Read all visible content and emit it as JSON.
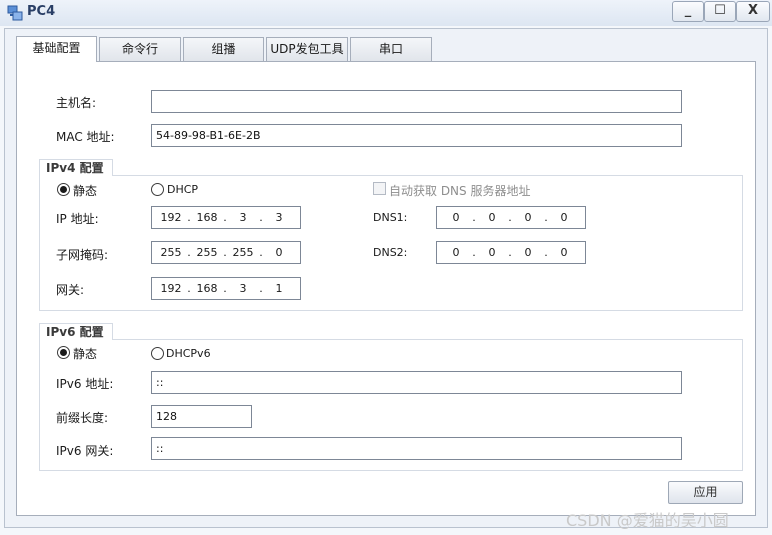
{
  "window": {
    "title": "PC4",
    "minimize": "_",
    "maximize": "☐",
    "close": "X"
  },
  "tabs": [
    {
      "label": "基础配置",
      "active": true
    },
    {
      "label": "命令行",
      "active": false
    },
    {
      "label": "组播",
      "active": false
    },
    {
      "label": "UDP发包工具",
      "active": false
    },
    {
      "label": "串口",
      "active": false
    }
  ],
  "basic": {
    "hostname_label": "主机名:",
    "hostname_value": "",
    "mac_label": "MAC 地址:",
    "mac_value": "54-89-98-B1-6E-2B"
  },
  "ipv4": {
    "section_title": "IPv4 配置",
    "static_label": "静态",
    "dhcp_label": "DHCP",
    "mode": "static",
    "auto_dns_label": "自动获取 DNS 服务器地址",
    "ip_label": "IP 地址:",
    "ip": [
      "192",
      "168",
      "3",
      "3"
    ],
    "mask_label": "子网掩码:",
    "mask": [
      "255",
      "255",
      "255",
      "0"
    ],
    "gateway_label": "网关:",
    "gateway": [
      "192",
      "168",
      "3",
      "1"
    ],
    "dns1_label": "DNS1:",
    "dns1": [
      "0",
      "0",
      "0",
      "0"
    ],
    "dns2_label": "DNS2:",
    "dns2": [
      "0",
      "0",
      "0",
      "0"
    ]
  },
  "ipv6": {
    "section_title": "IPv6 配置",
    "static_label": "静态",
    "dhcp_label": "DHCPv6",
    "mode": "static",
    "addr_label": "IPv6 地址:",
    "addr_value": "::",
    "prefix_label": "前缀长度:",
    "prefix_value": "128",
    "gateway_label": "IPv6 网关:",
    "gateway_value": "::"
  },
  "apply_label": "应用",
  "watermark": "CSDN @爱猫的吴小圆"
}
